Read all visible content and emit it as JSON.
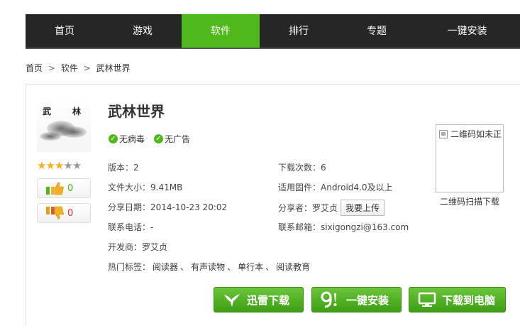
{
  "nav": {
    "items": [
      "首页",
      "游戏",
      "软件",
      "排行",
      "专题",
      "一键安装"
    ],
    "active": "软件"
  },
  "breadcrumb": {
    "items": [
      "首页",
      "软件",
      "武林世界"
    ],
    "separator": ">"
  },
  "app": {
    "logo_chars": [
      "武",
      "林"
    ],
    "title": "武林世界",
    "badges": [
      "无病毒",
      "无广告"
    ],
    "rating": {
      "stars": 3,
      "max": 5
    },
    "likes": "0",
    "dislikes": "0",
    "fields": {
      "version": "版本：2",
      "downloads": "下载次数：6",
      "size": "文件大小：9.41MB",
      "firmware": "适用固件：Android4.0及以上",
      "date": "分享日期：2014-10-23 20:02",
      "sharer_label": "分享者：罗艾贞",
      "upload_button": "我要上传",
      "phone": "联系电话：-",
      "email": "联系邮箱：sixigongzi@163.com",
      "developer": "开发商：罗艾贞",
      "tags_label": "热门标签："
    },
    "tags": [
      "阅读器",
      "有声读物",
      "单行本",
      "阅读教育"
    ],
    "tag_separator": "、"
  },
  "qr": {
    "alt_text": "二维码如未正",
    "caption": "二维码扫描下载"
  },
  "downloads": {
    "xunlei": "迅雷下载",
    "one_click": "一键安装",
    "to_pc": "下载到电脑"
  },
  "colors": {
    "accent": "#4fb81b",
    "nav_bg": "#262626",
    "dislike": "#dd3333",
    "star": "#f2b01e"
  }
}
